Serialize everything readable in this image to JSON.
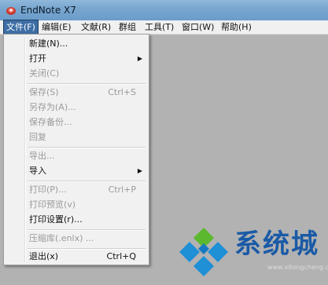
{
  "window": {
    "title": "EndNote X7"
  },
  "menubar": {
    "items": [
      {
        "label": "文件(F)",
        "open": true
      },
      {
        "label": "编辑(E)"
      },
      {
        "label": "文献(R)"
      },
      {
        "label": "群组"
      },
      {
        "label": "工具(T)"
      },
      {
        "label": "窗口(W)"
      },
      {
        "label": "帮助(H)"
      }
    ]
  },
  "file_menu": {
    "items": [
      {
        "label": "新建(N)...",
        "enabled": true
      },
      {
        "label": "打开",
        "enabled": true,
        "submenu": true
      },
      {
        "label": "关闭(C)",
        "enabled": false
      },
      {
        "label": "保存(S)",
        "shortcut": "Ctrl+S",
        "enabled": false
      },
      {
        "label": "另存为(A)...",
        "enabled": false
      },
      {
        "label": "保存备份...",
        "enabled": false
      },
      {
        "label": "回复",
        "enabled": false
      },
      {
        "label": "导出...",
        "enabled": false
      },
      {
        "label": "导入",
        "enabled": true,
        "submenu": true
      },
      {
        "label": "打印(P)...",
        "shortcut": "Ctrl+P",
        "enabled": false
      },
      {
        "label": "打印预览(v)",
        "enabled": false
      },
      {
        "label": "打印设置(r)...",
        "enabled": true
      },
      {
        "label": "压缩库(.enlx) ...",
        "enabled": false
      },
      {
        "label": "退出(x)",
        "shortcut": "Ctrl+Q",
        "enabled": true
      }
    ],
    "submenu_arrow": "▶"
  },
  "watermark": {
    "text": "系统城",
    "url": "www.xitongcheng.com"
  },
  "colors": {
    "titlebar": "#7aa7cf",
    "menu_highlight": "#3d6ea5",
    "disabled_text": "#9a9a9a",
    "watermark_blue": "#1a5aa6",
    "watermark_green": "#5cb82e"
  },
  "icons": {
    "app": "endnote-app-icon",
    "submenu": "triangle-right-icon",
    "watermark_logo": "diamond-logo-icon"
  }
}
